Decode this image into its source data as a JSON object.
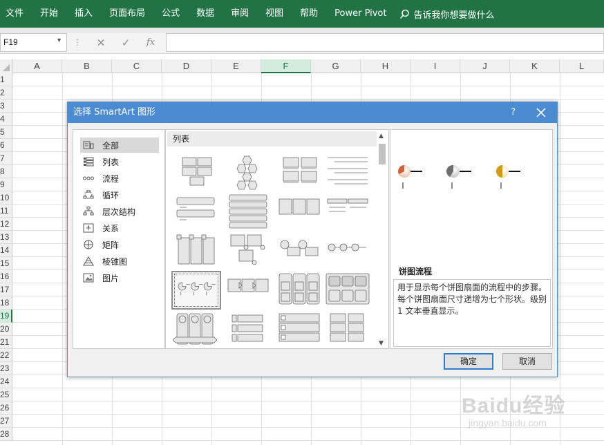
{
  "ribbon": {
    "tabs": [
      "文件",
      "开始",
      "插入",
      "页面布局",
      "公式",
      "数据",
      "审阅",
      "视图",
      "帮助",
      "Power Pivot"
    ],
    "tell_me": "告诉我你想要做什么",
    "color": "#217346"
  },
  "formula_bar": {
    "name_box": "F19",
    "fx": "fx"
  },
  "sheet": {
    "columns": [
      "A",
      "B",
      "C",
      "D",
      "E",
      "F",
      "G",
      "H",
      "I",
      "J",
      "K",
      "L"
    ],
    "rows": [
      "1",
      "2",
      "3",
      "4",
      "5",
      "6",
      "7",
      "8",
      "9",
      "10",
      "11",
      "12",
      "13",
      "14",
      "15",
      "16",
      "17",
      "18",
      "19",
      "20",
      "21",
      "22",
      "23",
      "24",
      "25",
      "26",
      "27",
      "28"
    ],
    "active_column": "F",
    "active_row": "19"
  },
  "dialog": {
    "title": "选择 SmartArt 图形",
    "help": "?",
    "categories": [
      {
        "label": "全部",
        "icon": "all-icon",
        "selected": true
      },
      {
        "label": "列表",
        "icon": "list-icon",
        "selected": false
      },
      {
        "label": "流程",
        "icon": "process-icon",
        "selected": false
      },
      {
        "label": "循环",
        "icon": "cycle-icon",
        "selected": false
      },
      {
        "label": "层次结构",
        "icon": "hierarchy-icon",
        "selected": false
      },
      {
        "label": "关系",
        "icon": "relationship-icon",
        "selected": false
      },
      {
        "label": "矩阵",
        "icon": "matrix-icon",
        "selected": false
      },
      {
        "label": "棱锥图",
        "icon": "pyramid-icon",
        "selected": false
      },
      {
        "label": "图片",
        "icon": "picture-icon",
        "selected": false
      }
    ],
    "layouts_header": "列表",
    "preview": {
      "title": "饼图流程",
      "description": "用于显示每个饼图扇面的流程中的步骤。每个饼图扇面尺寸递增为七个形状。级别 1 文本垂直显示。"
    },
    "ok_label": "确定",
    "cancel_label": "取消"
  },
  "watermark": {
    "brand": "Baidu经验",
    "url": "jingyan.baidu.com"
  }
}
